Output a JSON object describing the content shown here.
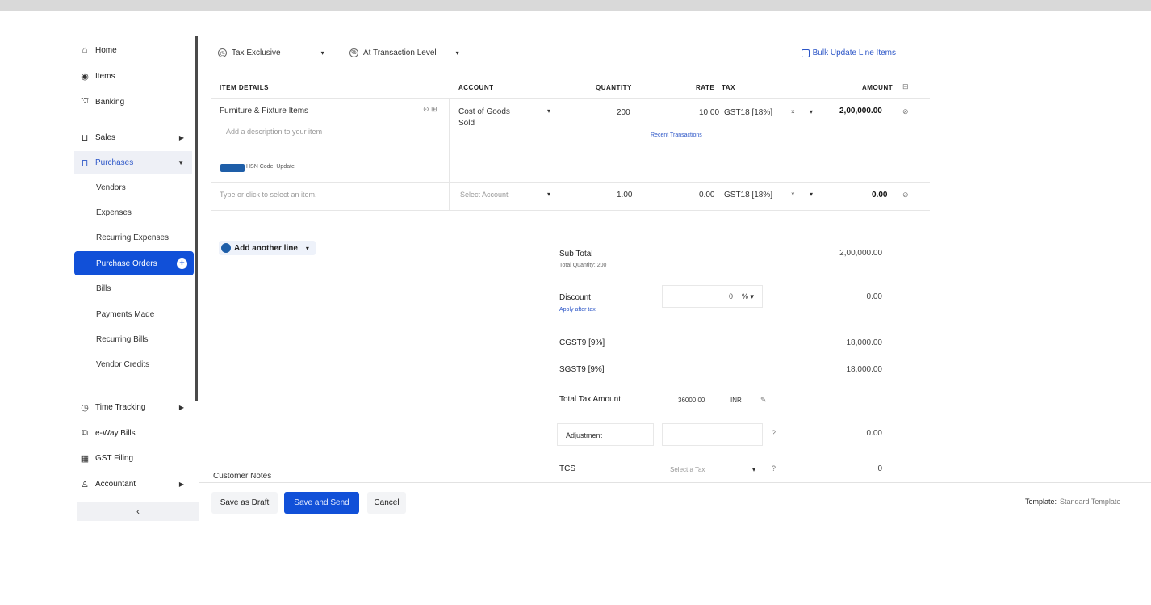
{
  "sidebar": {
    "items": [
      {
        "label": "Home"
      },
      {
        "label": "Items"
      },
      {
        "label": "Banking"
      },
      {
        "label": "Sales"
      },
      {
        "label": "Purchases"
      }
    ],
    "purchases_sub": [
      {
        "label": "Vendors"
      },
      {
        "label": "Expenses"
      },
      {
        "label": "Recurring Expenses"
      },
      {
        "label": "Purchase Orders"
      },
      {
        "label": "Bills"
      },
      {
        "label": "Payments Made"
      },
      {
        "label": "Recurring Bills"
      },
      {
        "label": "Vendor Credits"
      }
    ],
    "bottom_items": [
      {
        "label": "Time Tracking"
      },
      {
        "label": "e-Way Bills"
      },
      {
        "label": "GST Filing"
      },
      {
        "label": "Accountant"
      }
    ],
    "collapse": "‹"
  },
  "options": {
    "tax_mode": "Tax Exclusive",
    "discount_level": "At Transaction Level",
    "bulk_update": "Bulk Update Line Items"
  },
  "table": {
    "headers": {
      "item": "ITEM DETAILS",
      "account": "ACCOUNT",
      "quantity": "QUANTITY",
      "rate": "RATE",
      "tax": "TAX",
      "amount": "AMOUNT"
    },
    "rows": [
      {
        "item": "Furniture & Fixture Items",
        "description_placeholder": "Add a description to your item",
        "account": "Cost of Goods Sold",
        "quantity": "200",
        "rate": "10.00",
        "tax": "GST18 [18%]",
        "amount": "2,00,000.00",
        "convert_link": "Recent Transactions",
        "hsn": "HSN Code: Update"
      },
      {
        "item_placeholder": "Type or click to select an item.",
        "account": "Select Account",
        "quantity": "1.00",
        "rate": "0.00",
        "tax": "GST18 [18%]",
        "amount": "0.00"
      }
    ],
    "add_line": "Add another line"
  },
  "totals": {
    "subtotal_label": "Sub Total",
    "subtotal_sub": "Total Quantity: 200",
    "subtotal": "2,00,000.00",
    "discount_label": "Discount",
    "discount_link": "Apply after tax",
    "discount_value": "0",
    "discount_unit": "%",
    "discount_amount": "0.00",
    "cgst_label": "CGST9 [9%]",
    "cgst_value": "18,000.00",
    "sgst_label": "SGST9 [9%]",
    "sgst_value": "18,000.00",
    "total_tax_label": "Total Tax Amount",
    "total_tax_input": "36000.00",
    "total_tax_currency": "INR",
    "adjustment_label": "Adjustment",
    "adjustment_value": "0.00",
    "tcs_label": "TCS",
    "tcs_placeholder": "Select a Tax",
    "tcs_value": "0"
  },
  "footer": {
    "customer_notes": "Customer Notes",
    "save_draft": "Save as Draft",
    "save_send": "Save and Send",
    "cancel": "Cancel",
    "template_label": "Template:",
    "template_value": "Standard Template"
  },
  "colors": {
    "accent": "#1150d8",
    "link": "#2b55c7",
    "badge": "#1e5ea8"
  }
}
